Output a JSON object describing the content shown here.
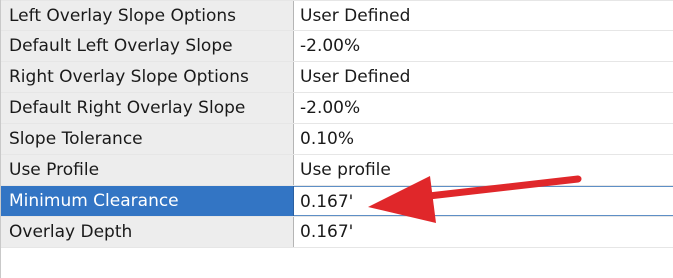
{
  "properties": [
    {
      "label": "Left Overlay Slope Options",
      "value": "User Defined"
    },
    {
      "label": "Default Left Overlay Slope",
      "value": "-2.00%"
    },
    {
      "label": "Right Overlay Slope Options",
      "value": "User Defined"
    },
    {
      "label": "Default Right Overlay Slope",
      "value": "-2.00%"
    },
    {
      "label": "Slope Tolerance",
      "value": "0.10%"
    },
    {
      "label": "Use Profile",
      "value": "Use profile"
    },
    {
      "label": "Minimum Clearance",
      "value": "0.167'"
    },
    {
      "label": "Overlay Depth",
      "value": "0.167'"
    }
  ],
  "selected_row": "Minimum Clearance",
  "colors": {
    "selection": "#3375c4",
    "label_background": "#ededed",
    "annotation_arrow": "#e0272a"
  },
  "annotation": {
    "icon": "red-arrow-icon",
    "points_to": "Minimum Clearance"
  }
}
